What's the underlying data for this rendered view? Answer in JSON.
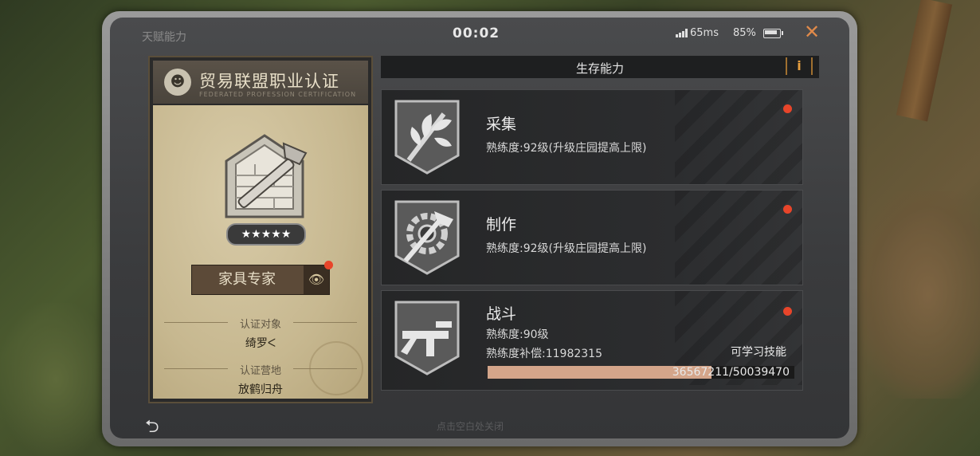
{
  "topbar": {
    "title": "天赋能力",
    "timer": "00:02",
    "ping": "65ms",
    "battery": "85%"
  },
  "certificate": {
    "title": "贸易联盟职业认证",
    "subtitle": "FEDERATED PROFESSION CERTIFICATION",
    "stars": "★★★★★",
    "rank_label": "家具专家",
    "target_label": "认证对象",
    "target_value": "绮罗ᐸ",
    "camp_label": "认证营地",
    "camp_value": "放鹤归舟"
  },
  "section": {
    "title": "生存能力",
    "info": "i"
  },
  "skills": [
    {
      "name": "采集",
      "proficiency": "熟练度:92级(升级庄园提高上限)"
    },
    {
      "name": "制作",
      "proficiency": "熟练度:92级(升级庄园提高上限)"
    },
    {
      "name": "战斗",
      "proficiency": "熟练度:90级",
      "compensation": "熟练度补偿:11982315",
      "learnable": "可学习技能",
      "progress_text": "36567211/50039470",
      "progress": 0.7308
    }
  ],
  "footer": {
    "hint": "点击空白处关闭"
  },
  "colors": {
    "accent": "#e08a4a",
    "red_dot": "#e8452a",
    "progress": "#d4a58a"
  }
}
